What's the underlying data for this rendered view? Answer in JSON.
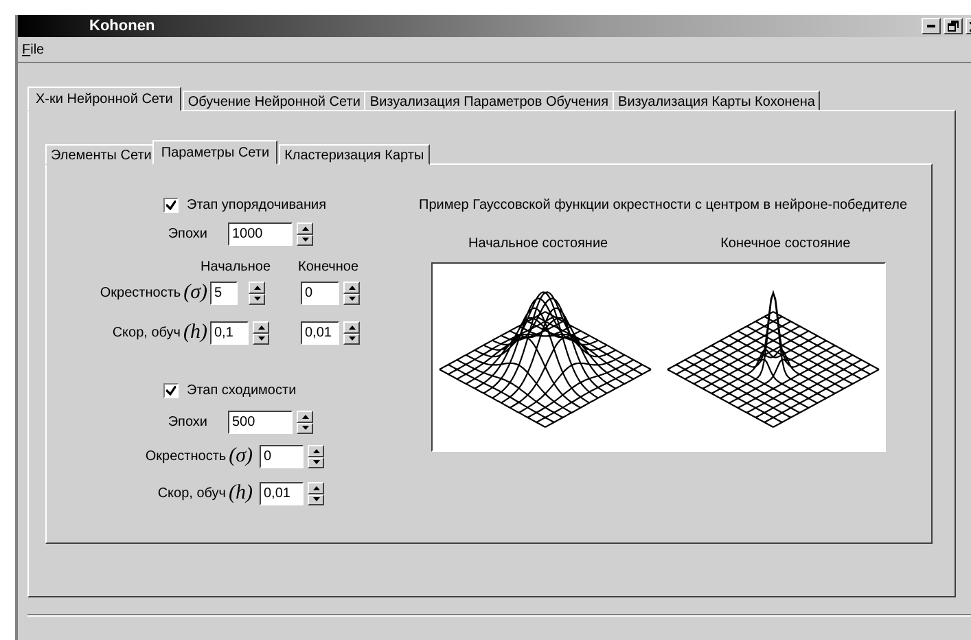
{
  "window": {
    "title": "Kohonen"
  },
  "menu": [
    {
      "label": "File"
    }
  ],
  "tabs": [
    {
      "label": "Х-ки Нейронной Сети",
      "selected": true
    },
    {
      "label": "Обучение Нейронной Сети",
      "selected": false
    },
    {
      "label": "Визуализация Параметров Обучения",
      "selected": false
    },
    {
      "label": "Визуализация Карты Кохонена",
      "selected": false
    }
  ],
  "subtabs": [
    {
      "label": "Элементы Сети",
      "selected": false
    },
    {
      "label": "Параметры Сети",
      "selected": true
    },
    {
      "label": "Кластеризация Карты",
      "selected": false
    }
  ],
  "ordering": {
    "label": "Этап упорядочивания",
    "checked": true,
    "epochs_label": "Эпохи",
    "epochs": "1000",
    "headers": [
      "Начальное",
      "Конечное"
    ],
    "neighborhood": {
      "label": "Окрестность",
      "symbol": "(σ)",
      "initial": "5",
      "final": "0"
    },
    "rate": {
      "label": "Скор, обуч",
      "symbol": "(h)",
      "initial": "0,1",
      "final": "0,01"
    }
  },
  "convergence": {
    "label": "Этап сходимости",
    "checked": true,
    "epochs_label": "Эпохи",
    "epochs": "500",
    "neighborhood": {
      "label": "Окрестность",
      "symbol": "(σ)",
      "value": "0"
    },
    "rate": {
      "label": "Скор, обуч",
      "symbol": "(h)",
      "value": "0,01"
    }
  },
  "example": {
    "caption": "Пример Гауссовской функции окрестности с центром в нейроне-победителе",
    "panels": [
      {
        "label": "Начальное состояние",
        "kind": "wide"
      },
      {
        "label": "Конечное состояние",
        "kind": "narrow"
      }
    ]
  }
}
